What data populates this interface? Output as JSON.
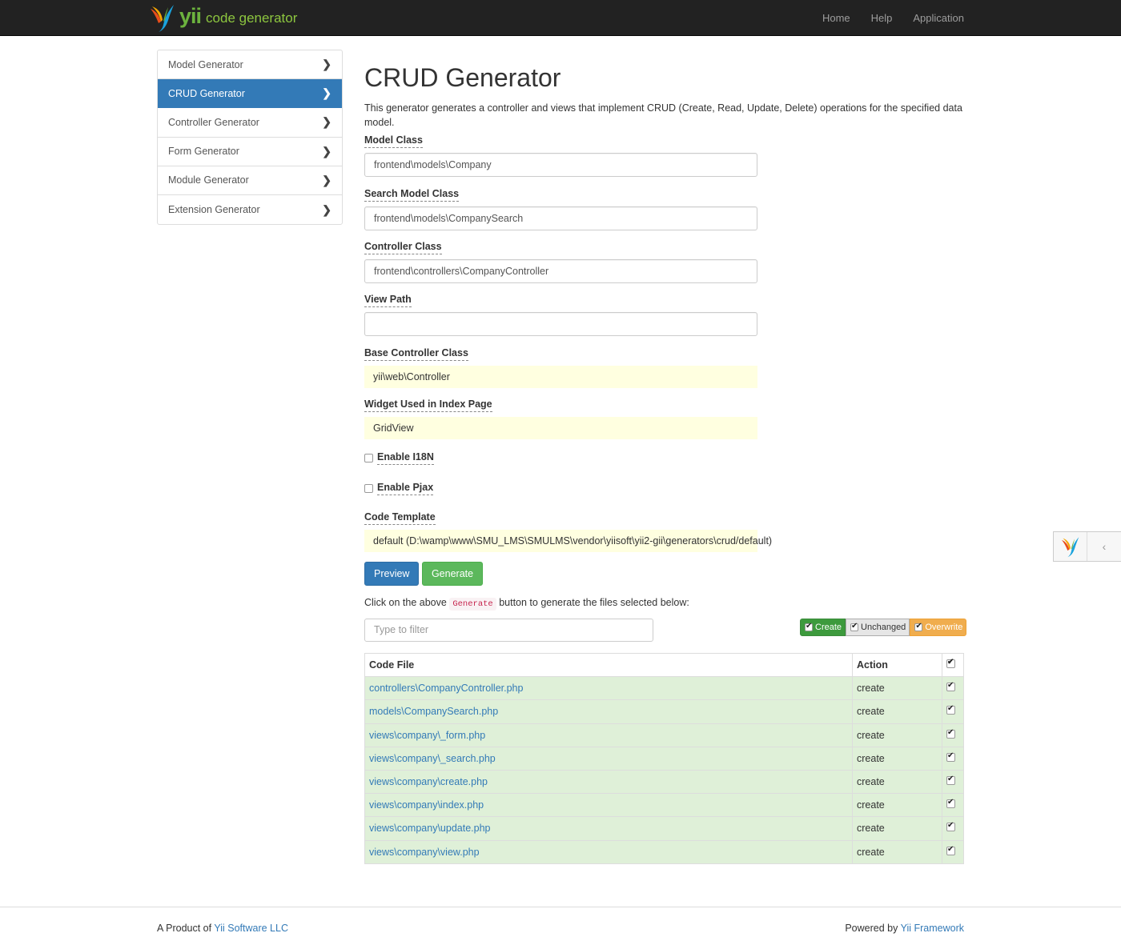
{
  "brand": {
    "logo_text": "yii",
    "subtitle": "code generator"
  },
  "nav": {
    "items": [
      "Home",
      "Help",
      "Application"
    ]
  },
  "sidebar": {
    "items": [
      {
        "label": "Model Generator",
        "active": false
      },
      {
        "label": "CRUD Generator",
        "active": true
      },
      {
        "label": "Controller Generator",
        "active": false
      },
      {
        "label": "Form Generator",
        "active": false
      },
      {
        "label": "Module Generator",
        "active": false
      },
      {
        "label": "Extension Generator",
        "active": false
      }
    ]
  },
  "page": {
    "title": "CRUD Generator",
    "description": "This generator generates a controller and views that implement CRUD (Create, Read, Update, Delete) operations for the specified data model."
  },
  "form": {
    "model_class": {
      "label": "Model Class",
      "value": "frontend\\models\\Company"
    },
    "search_model_class": {
      "label": "Search Model Class",
      "value": "frontend\\models\\CompanySearch"
    },
    "controller_class": {
      "label": "Controller Class",
      "value": "frontend\\controllers\\CompanyController"
    },
    "view_path": {
      "label": "View Path",
      "value": ""
    },
    "base_controller_class": {
      "label": "Base Controller Class",
      "value": "yii\\web\\Controller"
    },
    "index_widget": {
      "label": "Widget Used in Index Page",
      "value": "GridView"
    },
    "enable_i18n": {
      "label": "Enable I18N",
      "checked": false
    },
    "enable_pjax": {
      "label": "Enable Pjax",
      "checked": false
    },
    "code_template": {
      "label": "Code Template",
      "value": "default (D:\\wamp\\www\\SMU_LMS\\SMULMS\\vendor\\yiisoft\\yii2-gii\\generators\\crud/default)"
    }
  },
  "buttons": {
    "preview": "Preview",
    "generate": "Generate"
  },
  "hint": {
    "before": "Click on the above ",
    "code": "Generate",
    "after": " button to generate the files selected below:"
  },
  "filter": {
    "placeholder": "Type to filter"
  },
  "legend": {
    "create": "Create",
    "unchanged": "Unchanged",
    "overwrite": "Overwrite"
  },
  "colors": {
    "navbar": "#222222",
    "primary": "#337ab7",
    "success": "#5cb85c",
    "warning": "#f0ad4e",
    "row_create": "#dff0d8",
    "sticky_field": "#ffffe0"
  },
  "files": {
    "headers": {
      "code_file": "Code File",
      "action": "Action"
    },
    "rows": [
      {
        "file": "controllers\\CompanyController.php",
        "action": "create",
        "checked": true
      },
      {
        "file": "models\\CompanySearch.php",
        "action": "create",
        "checked": true
      },
      {
        "file": "views\\company\\_form.php",
        "action": "create",
        "checked": true
      },
      {
        "file": "views\\company\\_search.php",
        "action": "create",
        "checked": true
      },
      {
        "file": "views\\company\\create.php",
        "action": "create",
        "checked": true
      },
      {
        "file": "views\\company\\index.php",
        "action": "create",
        "checked": true
      },
      {
        "file": "views\\company\\update.php",
        "action": "create",
        "checked": true
      },
      {
        "file": "views\\company\\view.php",
        "action": "create",
        "checked": true
      }
    ]
  },
  "footer": {
    "left_text": "A Product of ",
    "left_link": "Yii Software LLC",
    "right_text": "Powered by ",
    "right_link": "Yii Framework"
  }
}
